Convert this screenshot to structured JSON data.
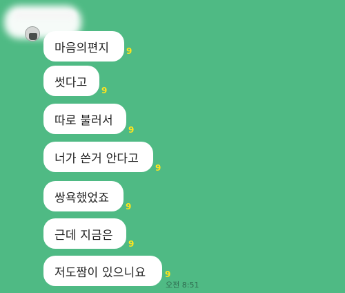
{
  "chat": {
    "messages": [
      {
        "text": "마음의편지",
        "unread": "9"
      },
      {
        "text": "썻다고",
        "unread": "9"
      },
      {
        "text": "따로 불러서",
        "unread": "9"
      },
      {
        "text": "너가 쓴거 안다고",
        "unread": "9"
      },
      {
        "text": "쌍욕했었죠",
        "unread": "9"
      },
      {
        "text": "근데 지금은",
        "unread": "9"
      },
      {
        "text": "저도짬이 있으니요",
        "unread": "9"
      }
    ],
    "timestamp": "오전 8:51"
  },
  "colors": {
    "background": "#4fba84",
    "bubble": "#ffffff",
    "unread_count": "#ffe41d",
    "timestamp": "#2f6a4f"
  }
}
